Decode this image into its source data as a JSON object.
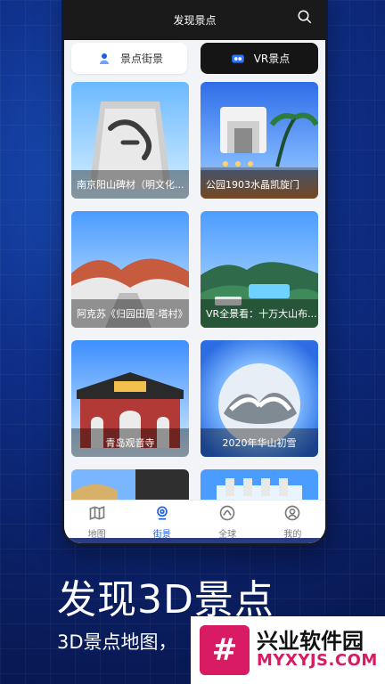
{
  "header": {
    "title": "发现景点"
  },
  "tabs": [
    {
      "label": "景点街景"
    },
    {
      "label": "VR景点"
    }
  ],
  "cards": [
    {
      "title": "南京阳山碑材（明文化..."
    },
    {
      "title": "公园1903水晶凯旋门"
    },
    {
      "title": "阿克苏《归园田居·塔村》"
    },
    {
      "title": "VR全景看：十万大山布..."
    },
    {
      "title": "青岛观音寺"
    },
    {
      "title": "2020年华山初雪"
    },
    {
      "title": ""
    },
    {
      "title": ""
    }
  ],
  "bottom_nav": [
    {
      "label": "地图",
      "icon": "map-icon"
    },
    {
      "label": "街景",
      "icon": "streetview-icon"
    },
    {
      "label": "全球",
      "icon": "globe-icon"
    },
    {
      "label": "我的",
      "icon": "user-icon"
    }
  ],
  "promo": {
    "title": "发现3D景点",
    "subtitle": "3D景点地图，"
  },
  "watermark": {
    "name": "兴业软件园",
    "url": "MYXYJS.COM"
  },
  "colors": {
    "accent": "#1d5fe2",
    "dark": "#151515",
    "bg": "#0f2f8a",
    "watermark": "#d81b63"
  }
}
